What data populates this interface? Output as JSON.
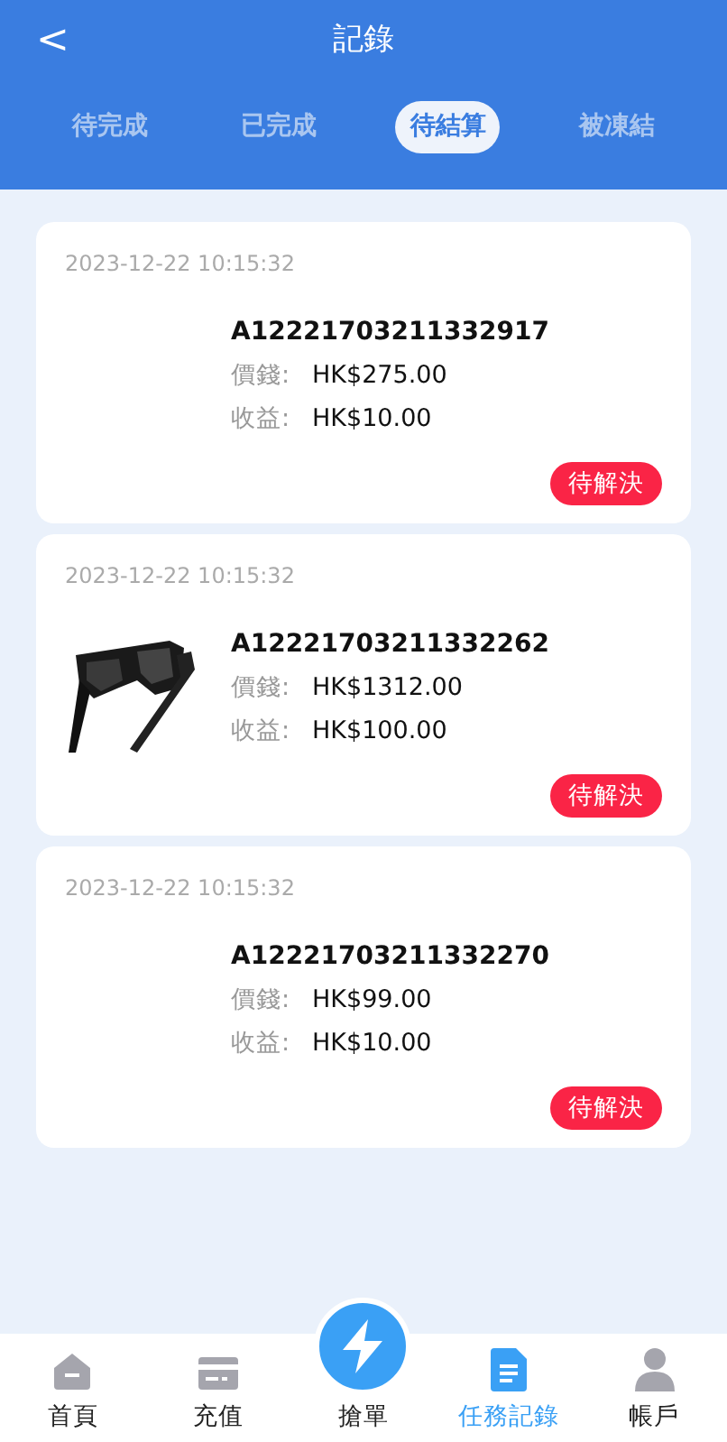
{
  "header": {
    "back": "<",
    "title": "記錄"
  },
  "tabs": [
    {
      "label": "待完成",
      "selected": false
    },
    {
      "label": "已完成",
      "selected": false
    },
    {
      "label": "待結算",
      "selected": true
    },
    {
      "label": "被凍結",
      "selected": false
    }
  ],
  "orders": [
    {
      "time": "2023-12-22 10:15:32",
      "order_no": "A12221703211332917",
      "price_label": "價錢:",
      "price": "HK$275.00",
      "profit_label": "收益:",
      "profit": "HK$10.00",
      "status": "待解決"
    },
    {
      "time": "2023-12-22 10:15:32",
      "order_no": "A12221703211332262",
      "price_label": "價錢:",
      "price": "HK$1312.00",
      "profit_label": "收益:",
      "profit": "HK$100.00",
      "status": "待解決"
    },
    {
      "time": "2023-12-22 10:15:32",
      "order_no": "A12221703211332270",
      "price_label": "價錢:",
      "price": "HK$99.00",
      "profit_label": "收益:",
      "profit": "HK$10.00",
      "status": "待解決"
    }
  ],
  "bottom_nav": [
    {
      "kind": "home",
      "label": "首頁",
      "selected": false
    },
    {
      "kind": "card",
      "label": "充值",
      "selected": false
    },
    {
      "kind": "bolt",
      "label": "搶單",
      "selected": false
    },
    {
      "kind": "doc",
      "label": "任務記錄",
      "selected": true
    },
    {
      "kind": "user",
      "label": "帳戶",
      "selected": false
    }
  ]
}
